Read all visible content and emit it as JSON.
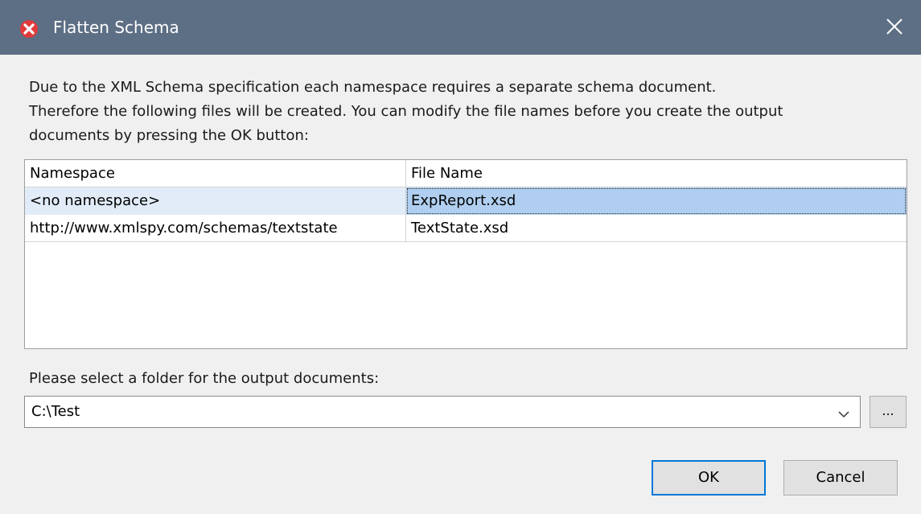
{
  "window": {
    "title": "Flatten Schema",
    "icon": "xmlspy-app-icon",
    "close_icon": "close-icon"
  },
  "description": "Due to the XML Schema specification each namespace requires a separate schema document.\nTherefore the following files will be created. You can modify the file names before you create the output\ndocuments by pressing the OK button:",
  "table": {
    "columns": [
      "Namespace",
      "File Name"
    ],
    "rows": [
      {
        "namespace": "<no namespace>",
        "file_name": "ExpReport.xsd",
        "selected": true
      },
      {
        "namespace": "http://www.xmlspy.com/schemas/textstate",
        "file_name": "TextState.xsd",
        "selected": false
      }
    ]
  },
  "folder": {
    "label": "Please select a folder for the output documents:",
    "value": "C:\\Test",
    "browse_label": "..."
  },
  "buttons": {
    "ok": "OK",
    "cancel": "Cancel"
  },
  "colors": {
    "titlebar": "#5d6f85",
    "selection": "#b0cff0",
    "focus_border": "#0078d7"
  }
}
